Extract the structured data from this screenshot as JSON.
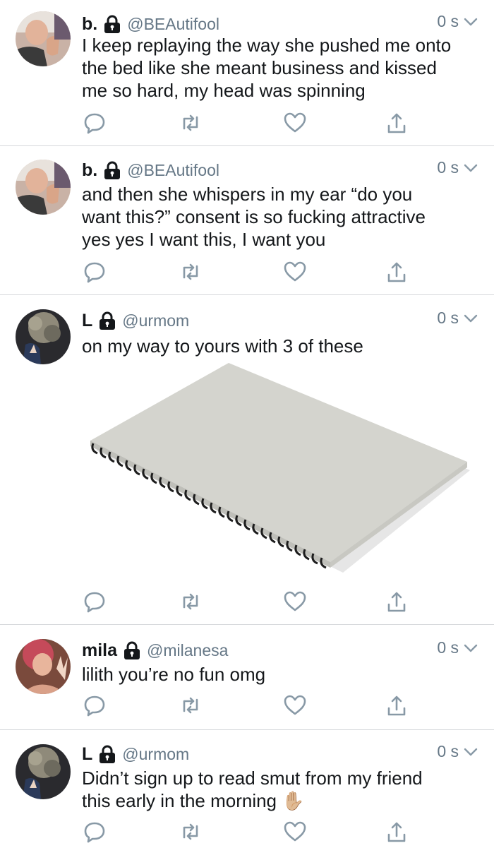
{
  "colors": {
    "text": "#14171a",
    "secondary": "#657786",
    "divider": "#d6d9dc",
    "icon": "#8899a6"
  },
  "icons": [
    "lock-icon",
    "chevron-down-icon",
    "reply-icon",
    "retweet-icon",
    "like-icon",
    "share-icon",
    "raised-hand-emoji"
  ],
  "tweets": [
    {
      "name": "b.",
      "handle": "@BEAutifool",
      "time": "0 s",
      "lines": [
        "I keep replaying the way she pushed me onto",
        "the bed like she meant business and kissed",
        "me so hard, my head was spinning"
      ]
    },
    {
      "name": "b.",
      "handle": "@BEAutifool",
      "time": "0 s",
      "lines": [
        "and then she whispers in my ear “do you",
        "want this?” consent is so fucking attractive",
        "yes yes I want this, I want you"
      ]
    },
    {
      "name": "L",
      "handle": "@urmom",
      "time": "0 s",
      "lines": [
        "on my way to yours with 3 of these"
      ],
      "media": "spiral notebook photo"
    },
    {
      "name": "mila",
      "handle": "@milanesa",
      "time": "0 s",
      "lines": [
        "lilith you’re no fun omg"
      ]
    },
    {
      "name": "L",
      "handle": "@urmom",
      "time": "0 s",
      "lines": [
        "Didn’t sign up to read smut from my friend",
        "this early in the morning"
      ],
      "emoji": "✋🏼"
    }
  ]
}
